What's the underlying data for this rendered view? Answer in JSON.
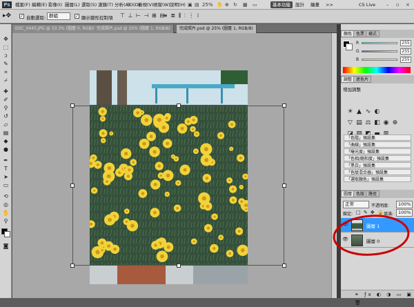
{
  "app": {
    "logo": "Ps",
    "zoom": "25%"
  },
  "menu": [
    "檔案(F)",
    "編輯(E)",
    "影像(I)",
    "圖層(L)",
    "選取(S)",
    "濾鏡(T)",
    "分析(A)",
    "3D(D)",
    "檢視(V)",
    "視窗(W)",
    "說明(H)"
  ],
  "workspace": {
    "active": "基本功能",
    "items": [
      "設計",
      "繪畫",
      ">>"
    ],
    "cslive": "CS Live"
  },
  "options": {
    "autoselect_label": "自動選取:",
    "autoselect_value": "群組",
    "transform_label": "顯示變形控制項"
  },
  "tabs": [
    "DSC_0445.JPG @ 33.3% (圖層 0, RGB/8)",
    "完成照片.psd @ 25% (圖層 1, RGB/8)",
    "完成照片.psd @ 25% (圖層 1, RGB/8)"
  ],
  "color_panel": {
    "tabs": [
      "顏色",
      "色票",
      "樣式"
    ],
    "channels": [
      {
        "label": "R",
        "value": "255"
      },
      {
        "label": "G",
        "value": "255"
      },
      {
        "label": "B",
        "value": "255"
      }
    ]
  },
  "adjust_panel": {
    "tabs": [
      "調整",
      "遮色片"
    ],
    "title": "增加調整",
    "presets": [
      "「色階」預設集",
      "「曲線」預設集",
      "「曝光度」預設集",
      "「色相/飽和度」預設集",
      "「黑白」預設集",
      "「色版混合器」預設集",
      "「選取顏色」預設集"
    ]
  },
  "layers_panel": {
    "tabs": [
      "圖層",
      "色版",
      "路徑"
    ],
    "blend_mode": "正常",
    "opacity_label": "不透明度:",
    "opacity_value": "100%",
    "lock_label": "鎖定:",
    "fill_label": "填滿:",
    "fill_value": "100%",
    "layers": [
      {
        "name": "圖層 1",
        "selected": true
      },
      {
        "name": "圖層 0",
        "selected": false
      }
    ]
  },
  "colors": {
    "selection": "#3399ff",
    "annotation": "#cc0000"
  }
}
